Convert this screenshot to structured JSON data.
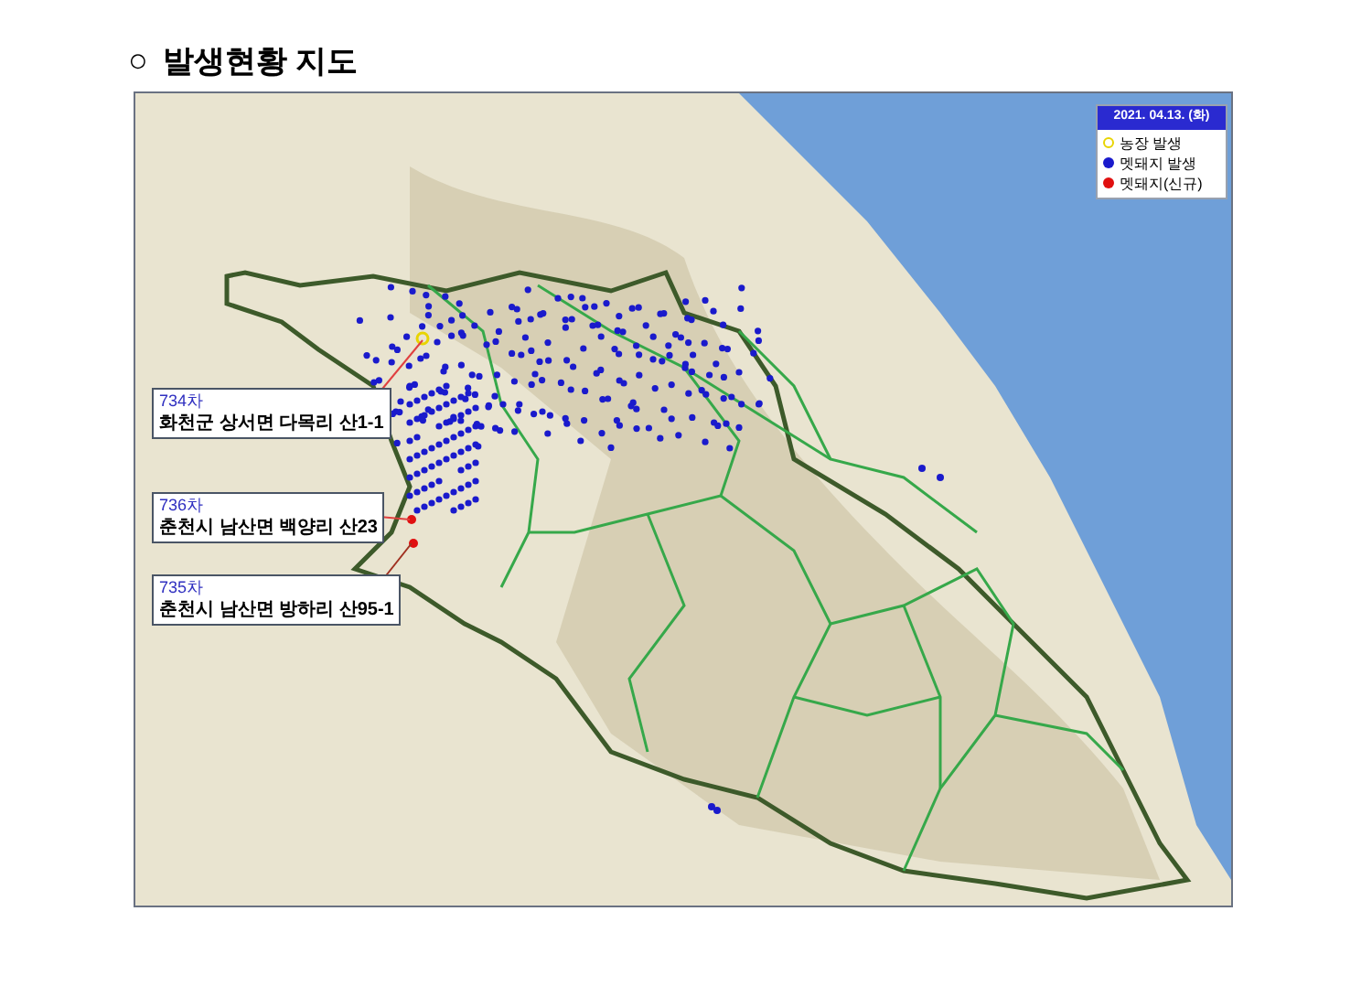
{
  "title": {
    "bullet": "○",
    "text": "발생현황 지도"
  },
  "legend": {
    "date": "2021. 04.13. (화)",
    "items": [
      {
        "kind": "ring",
        "label": "농장 발생",
        "color": "#e8d400"
      },
      {
        "kind": "dot",
        "label": "멧돼지 발생",
        "color": "#1a1acc"
      },
      {
        "kind": "dot",
        "label": "멧돼지(신규)",
        "color": "#e01010"
      }
    ]
  },
  "callouts": [
    {
      "number": "734차",
      "address": "화천군 상서면 다목리 산1-1"
    },
    {
      "number": "736차",
      "address": "춘천시 남산면 백양리 산23"
    },
    {
      "number": "735차",
      "address": "춘천시 남산면 방하리 산95-1"
    }
  ]
}
